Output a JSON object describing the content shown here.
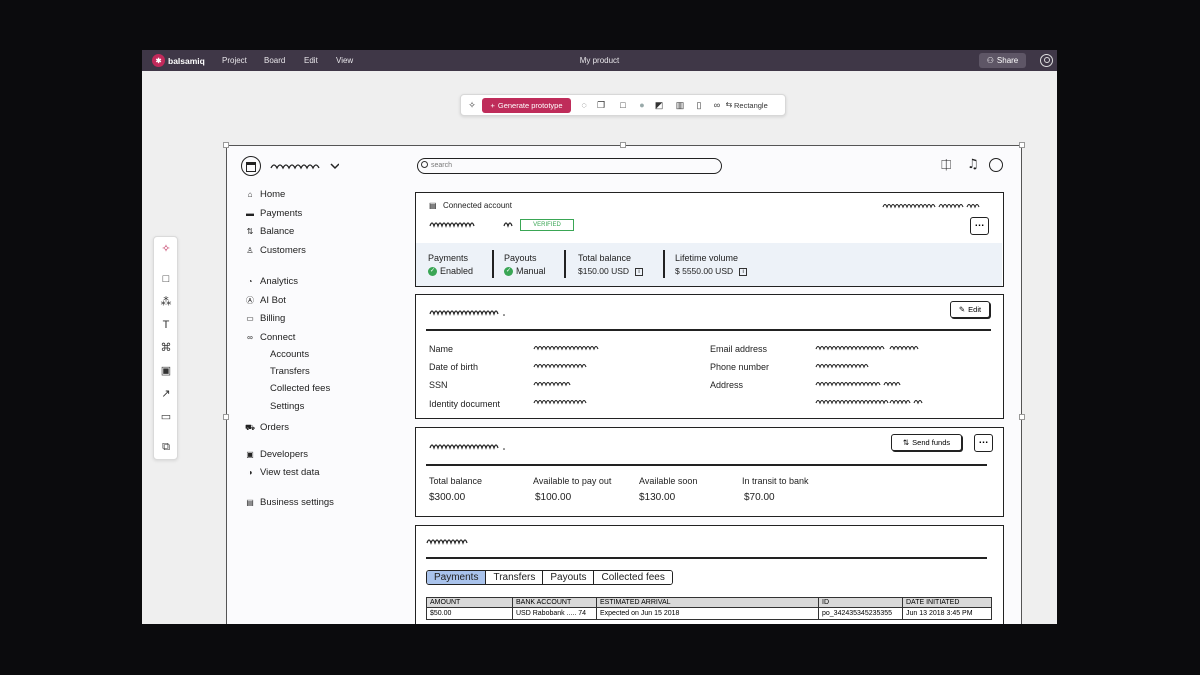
{
  "app": {
    "brand": "balsamiq",
    "menu": [
      "Project",
      "Board",
      "Edit",
      "View"
    ],
    "document_title": "My product",
    "share_label": "Share"
  },
  "toolbar": {
    "generate_label": "Generate prototype",
    "shape_label": "Rectangle"
  },
  "mock": {
    "search_placeholder": "search",
    "nav": [
      {
        "label": "Home",
        "icon": "home-icon"
      },
      {
        "label": "Payments",
        "icon": "payments-icon"
      },
      {
        "label": "Balance",
        "icon": "balance-icon"
      },
      {
        "label": "Customers",
        "icon": "customers-icon"
      },
      {
        "label": "Analytics",
        "icon": "analytics-icon"
      },
      {
        "label": "AI Bot",
        "icon": "ai-bot-icon"
      },
      {
        "label": "Billing",
        "icon": "billing-icon"
      },
      {
        "label": "Connect",
        "icon": "connect-icon"
      },
      {
        "label": "Orders",
        "icon": "orders-icon"
      },
      {
        "label": "Developers",
        "icon": "developers-icon"
      },
      {
        "label": "View test data",
        "icon": "toggle-icon"
      },
      {
        "label": "Business settings",
        "icon": "business-icon"
      }
    ],
    "connect_sub": [
      "Accounts",
      "Transfers",
      "Collected fees",
      "Settings"
    ],
    "account_panel": {
      "heading": "Connected account",
      "badge": "VERIFIED",
      "stats": [
        {
          "label": "Payments",
          "value": "Enabled",
          "status": "check"
        },
        {
          "label": "Payouts",
          "value": "Manual",
          "status": "check"
        },
        {
          "label": "Total balance",
          "value": "$150.00 USD",
          "status": "info"
        },
        {
          "label": "Lifetime volume",
          "value": "$ 5550.00 USD",
          "status": "info"
        }
      ]
    },
    "details_panel": {
      "edit_label": "Edit",
      "left_fields": [
        "Name",
        "Date of birth",
        "SSN",
        "Identity document"
      ],
      "right_fields": [
        "Email address",
        "Phone number",
        "Address"
      ]
    },
    "balance_panel": {
      "send_label": "Send funds",
      "stats": [
        {
          "label": "Total balance",
          "value": "$300.00"
        },
        {
          "label": "Available to pay out",
          "value": "$100.00"
        },
        {
          "label": "Available soon",
          "value": "$130.00"
        },
        {
          "label": "In transit to bank",
          "value": "$70.00"
        }
      ]
    },
    "activity_panel": {
      "tabs": [
        "Payments",
        "Transfers",
        "Payouts",
        "Collected fees"
      ],
      "active_tab": "Payments",
      "columns": [
        "AMOUNT",
        "BANK ACCOUNT",
        "ESTIMATED ARRIVAL",
        "ID",
        "DATE INITIATED"
      ],
      "rows": [
        [
          "$50.00",
          "USD Rabobank ..... 74",
          "Expected on Jun 15 2018",
          "po_342435345235355",
          "Jun 13 2018 3:45 PM"
        ]
      ]
    }
  },
  "colors": {
    "topbar": "#3f3747",
    "accent": "#bf2c5a",
    "active_tab": "#a9c3ec",
    "verified": "#3aa655"
  }
}
